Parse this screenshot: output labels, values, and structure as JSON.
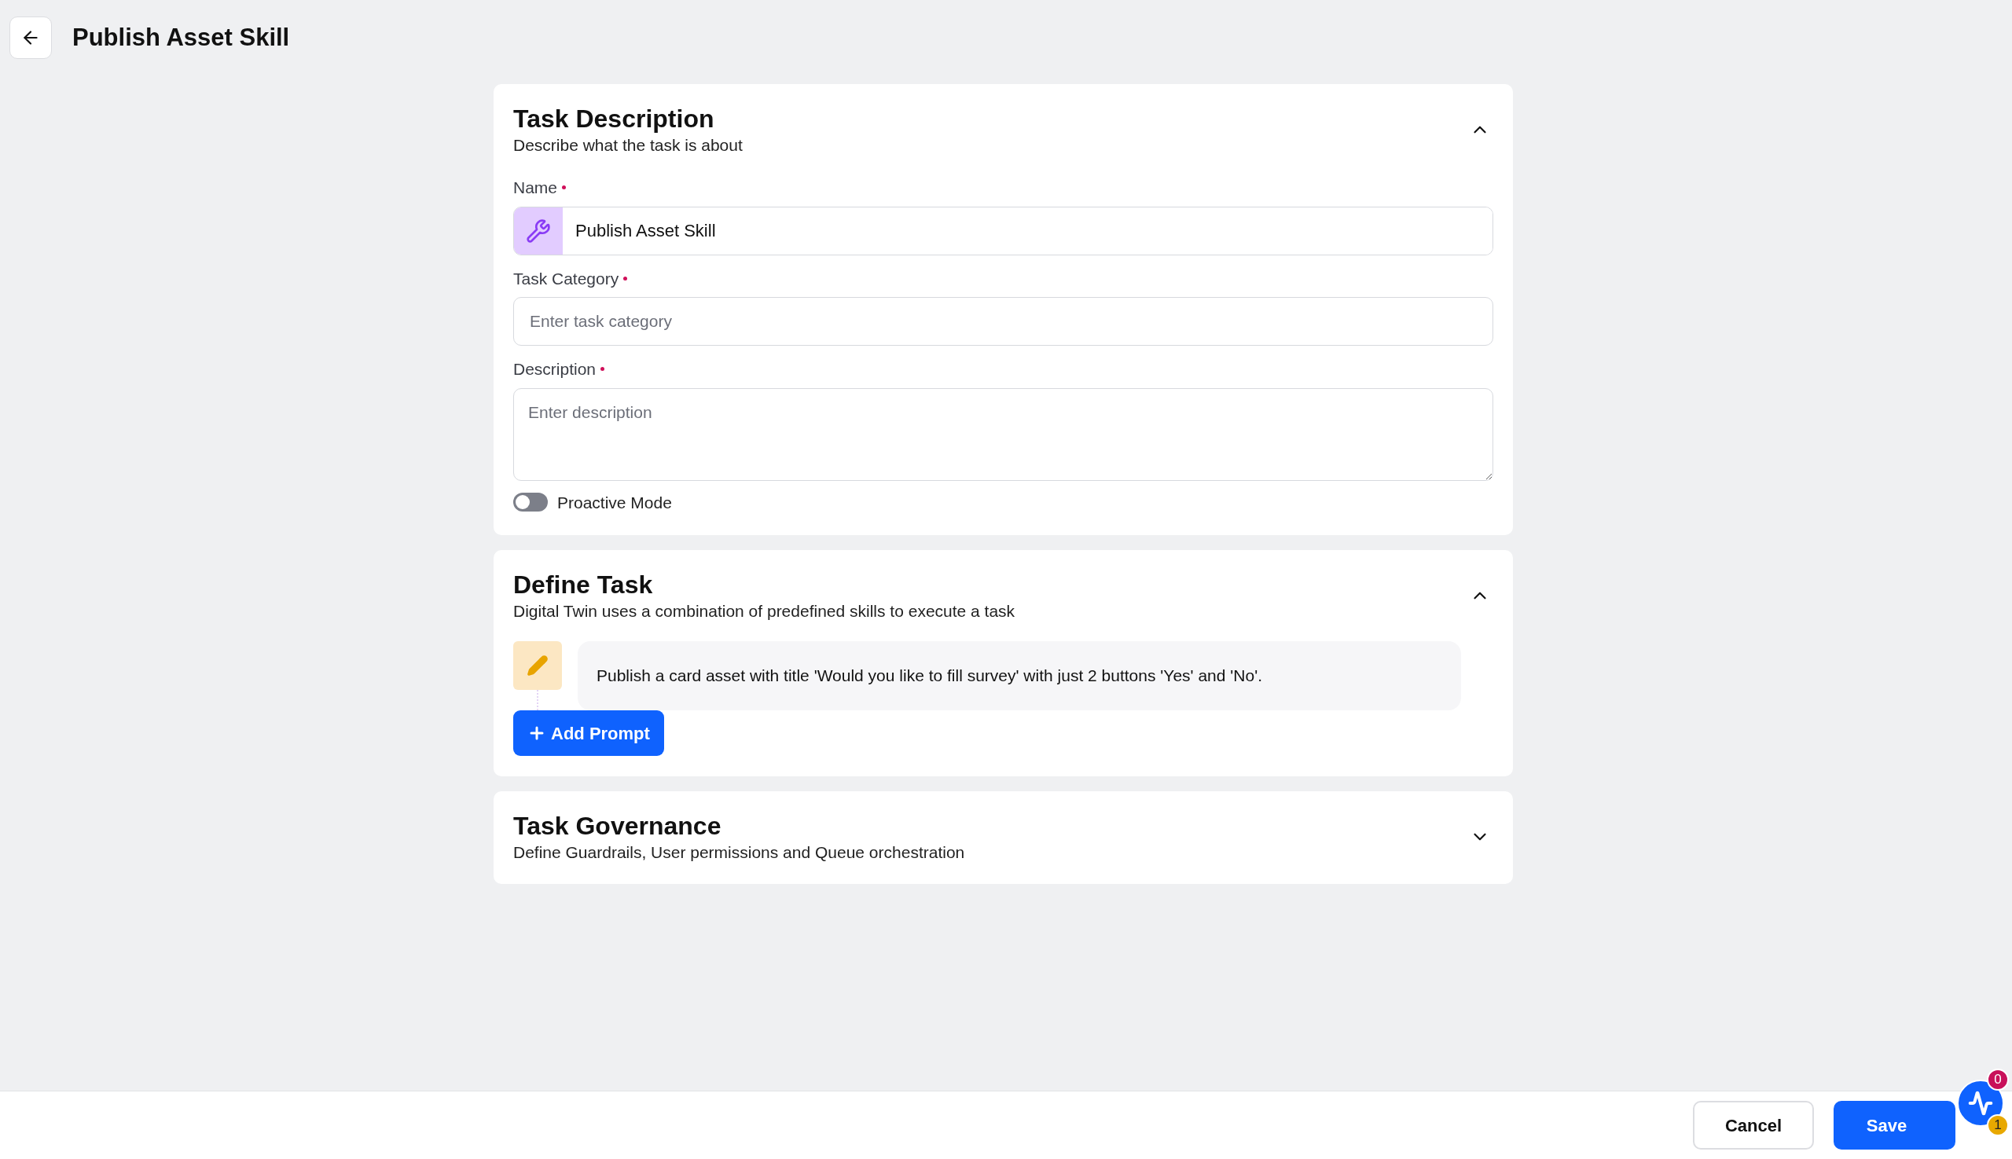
{
  "header": {
    "title": "Publish Asset Skill"
  },
  "sections": [
    {
      "kind": "form",
      "title": "Task Description",
      "subtitle": "Describe what the task is about",
      "expanded": true,
      "fields": [
        {
          "kind": "icon-input",
          "label": "Name",
          "required": true,
          "value": "Publish Asset Skill"
        },
        {
          "kind": "input",
          "label": "Task Category",
          "required": true,
          "placeholder": "Enter task category"
        },
        {
          "kind": "textarea",
          "label": "Description",
          "required": true,
          "placeholder": "Enter description"
        }
      ],
      "toggle": {
        "label": "Proactive Mode",
        "on": false
      }
    },
    {
      "kind": "prompts",
      "title": "Define Task",
      "subtitle": "Digital Twin uses a combination of predefined skills to execute a task",
      "expanded": true,
      "prompts": [
        "Publish a card asset with title 'Would you like to fill survey' with just 2 buttons 'Yes' and 'No'."
      ],
      "add_button": "Add Prompt"
    },
    {
      "title": "Task Governance",
      "subtitle": "Define Guardrails, User permissions and Queue orchestration",
      "expanded": false
    }
  ],
  "footer": {
    "buttons": [
      {
        "kind": "secondary",
        "label": "Cancel"
      },
      {
        "kind": "primary",
        "label": "Save"
      }
    ]
  },
  "widget": {
    "badges": [
      {
        "label": "0",
        "color": "#c8105a"
      },
      {
        "label": "1",
        "color": "#e8a800"
      }
    ]
  }
}
